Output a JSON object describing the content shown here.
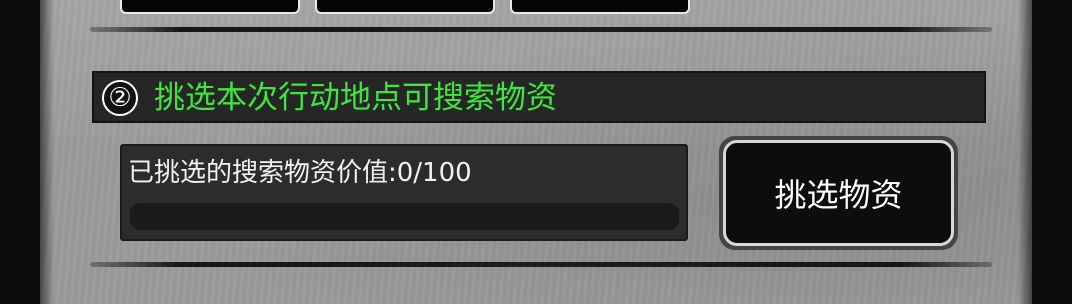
{
  "step": {
    "number": "②",
    "title": "挑选本次行动地点可搜索物资"
  },
  "search_value": {
    "label": "已挑选的搜索物资价值:0/100",
    "current": 0,
    "max": 100,
    "progress_fraction": 0
  },
  "pick_button": {
    "label": "挑选物资"
  },
  "colors": {
    "title_green": "#3ee63e",
    "panel_dark": "#262626",
    "paper_gray": "#9c9c9c"
  }
}
